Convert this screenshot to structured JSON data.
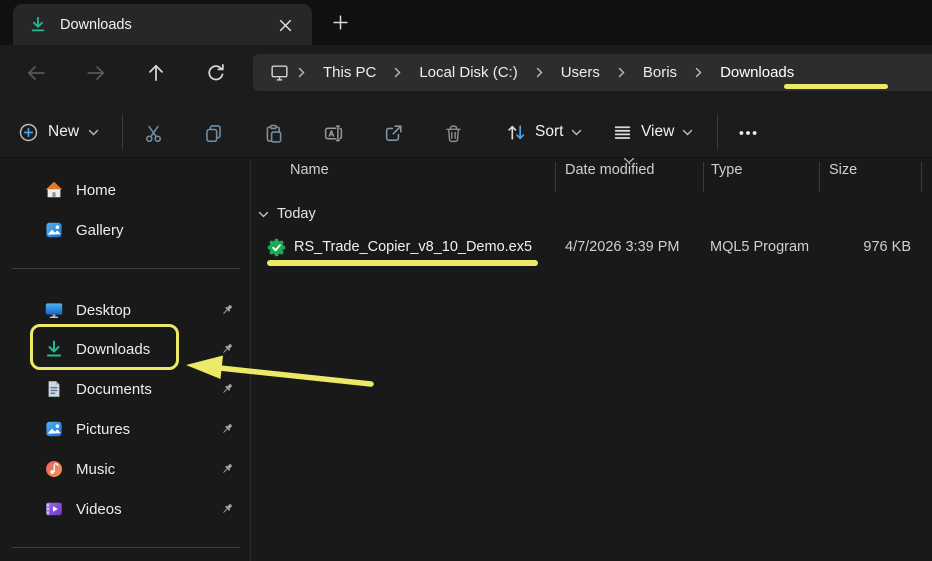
{
  "window": {
    "tab_title": "Downloads"
  },
  "nav": {
    "breadcrumb": [
      "This PC",
      "Local Disk (C:)",
      "Users",
      "Boris",
      "Downloads"
    ]
  },
  "toolbar": {
    "new_label": "New",
    "sort_label": "Sort",
    "view_label": "View"
  },
  "sidebar": {
    "items": [
      {
        "label": "Home",
        "pinned": false
      },
      {
        "label": "Gallery",
        "pinned": false
      },
      {
        "label": "Desktop",
        "pinned": true
      },
      {
        "label": "Downloads",
        "pinned": true,
        "highlighted": true
      },
      {
        "label": "Documents",
        "pinned": true
      },
      {
        "label": "Pictures",
        "pinned": true
      },
      {
        "label": "Music",
        "pinned": true
      },
      {
        "label": "Videos",
        "pinned": true
      }
    ]
  },
  "main": {
    "columns": [
      "Name",
      "Date modified",
      "Type",
      "Size"
    ],
    "group_label": "Today",
    "files": [
      {
        "name": "RS_Trade_Copier_v8_10_Demo.ex5",
        "date_modified": "4/7/2026 3:39 PM",
        "type": "MQL5 Program",
        "size": "976 KB"
      }
    ]
  },
  "colors": {
    "highlight_yellow": "#ece968",
    "downloads_teal": "#28b795",
    "accent_blue": "#4aa3e8",
    "file_icon_green": "#1fab55"
  }
}
